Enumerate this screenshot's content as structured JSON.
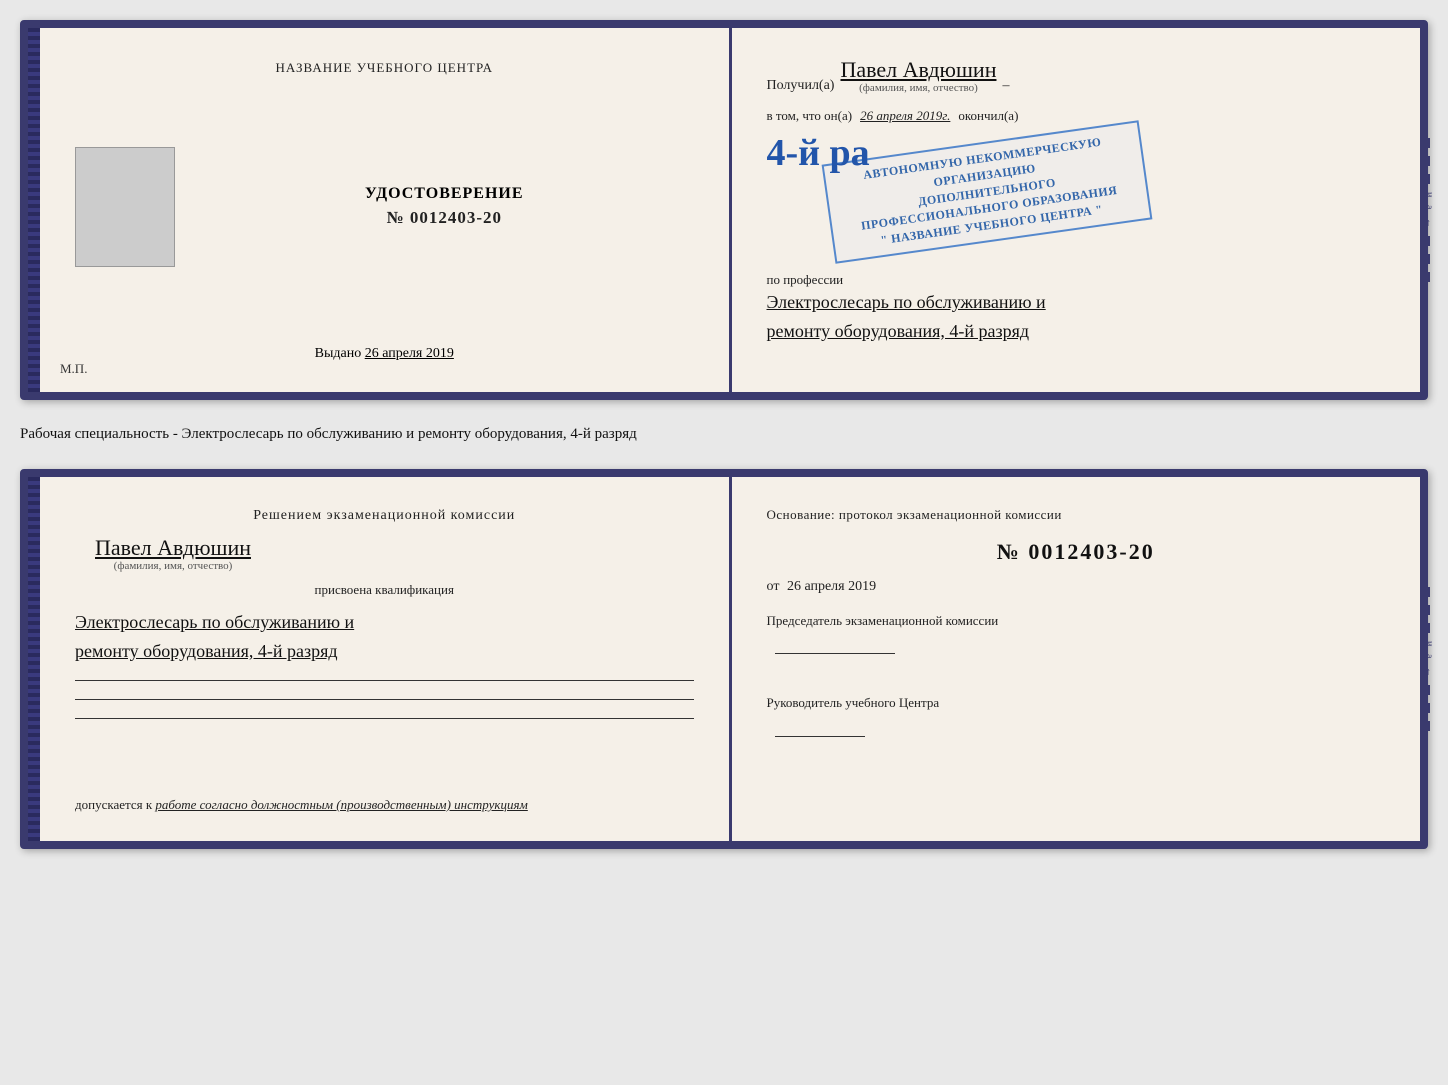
{
  "top_left": {
    "training_center_label": "НАЗВАНИЕ УЧЕБНОГО ЦЕНТРА",
    "cert_label": "УДОСТОВЕРЕНИЕ",
    "cert_number": "№ 0012403-20",
    "issued_label": "Выдано",
    "issued_date": "26 апреля 2019",
    "mp_label": "М.П."
  },
  "top_right": {
    "received_prefix": "Получил(а)",
    "recipient_name": "Павел Авдюшин",
    "name_field_label": "(фамилия, имя, отчество)",
    "in_that_prefix": "в том, что он(а)",
    "completion_date": "26 апреля 2019г.",
    "finished_label": "окончил(а)",
    "stamp_line1": "4-й ра",
    "stamp_line2": "АВТОНОМНУЮ НЕКОММЕРЧЕСКУЮ ОРГАНИЗАЦИЮ",
    "stamp_line3": "ДОПОЛНИТЕЛЬНОГО ПРОФЕССИОНАЛЬНОГО ОБРАЗОВАНИЯ",
    "stamp_line4": "\" НАЗВАНИЕ УЧЕБНОГО ЦЕНТРА \"",
    "profession_prefix": "по профессии",
    "profession_line1": "Электрослесарь по обслуживанию и",
    "profession_line2": "ремонту оборудования, 4-й разряд"
  },
  "middle_text": "Рабочая специальность - Электрослесарь по обслуживанию и ремонту оборудования, 4-й разряд",
  "bottom_left": {
    "decision_line1": "Решением экзаменационной  комиссии",
    "person_name": "Павел Авдюшин",
    "name_field_label": "(фамилия, имя, отчество)",
    "assigned_label": "присвоена квалификация",
    "qual_line1": "Электрослесарь по обслуживанию и",
    "qual_line2": "ремонту оборудования, 4-й разряд",
    "allowed_prefix": "допускается к",
    "allowed_text": "работе согласно должностным (производственным) инструкциям"
  },
  "bottom_right": {
    "basis_label": "Основание: протокол экзаменационной  комиссии",
    "protocol_number": "№  0012403-20",
    "from_prefix": "от",
    "from_date": "26 апреля 2019",
    "chairman_label": "Председатель экзаменационной комиссии",
    "director_label": "Руководитель учебного Центра"
  },
  "side_chars": [
    "–",
    "–",
    "–",
    "и",
    "а",
    "←",
    "–",
    "–",
    "–",
    "–"
  ]
}
